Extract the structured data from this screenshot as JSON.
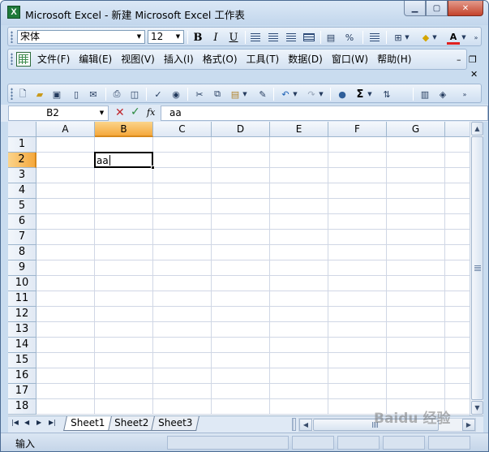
{
  "window": {
    "title": "Microsoft Excel - 新建 Microsoft Excel 工作表",
    "app_icon": "excel-icon",
    "controls": [
      "minimize",
      "maximize",
      "close"
    ]
  },
  "format_toolbar": {
    "font_name": "宋体",
    "font_size": "12",
    "bold_label": "B",
    "italic_label": "I",
    "underline_label": "U",
    "icons": [
      "align-left-icon",
      "align-center-icon",
      "align-right-icon",
      "merge-center-icon",
      "currency-icon",
      "percent-icon",
      "indent-icon",
      "borders-icon",
      "fill-color-icon",
      "font-color-icon"
    ],
    "percent_label": "%",
    "font_color_label": "A"
  },
  "menu": {
    "items": [
      {
        "label": "文件(F)"
      },
      {
        "label": "编辑(E)"
      },
      {
        "label": "视图(V)"
      },
      {
        "label": "插入(I)"
      },
      {
        "label": "格式(O)"
      },
      {
        "label": "工具(T)"
      },
      {
        "label": "数据(D)"
      },
      {
        "label": "窗口(W)"
      },
      {
        "label": "帮助(H)"
      }
    ]
  },
  "standard_toolbar": {
    "icons": [
      "new-icon",
      "open-icon",
      "save-icon",
      "permission-icon",
      "email-icon",
      "print-icon",
      "print-preview-icon",
      "spelling-icon",
      "research-icon",
      "cut-icon",
      "copy-icon",
      "paste-icon",
      "format-painter-icon",
      "undo-icon",
      "redo-icon",
      "hyperlink-icon",
      "autosum-icon",
      "sort-icon",
      "chart-wizard-icon",
      "more-icon"
    ],
    "autosum_label": "Σ"
  },
  "formula_bar": {
    "name_box": "B2",
    "cancel_label": "✕",
    "enter_label": "✓",
    "fx_label": "fx",
    "content": "aa"
  },
  "grid": {
    "columns": [
      "A",
      "B",
      "C",
      "D",
      "E",
      "F",
      "G"
    ],
    "rows": [
      "1",
      "2",
      "3",
      "4",
      "5",
      "6",
      "7",
      "8",
      "9",
      "10",
      "11",
      "12",
      "13",
      "14",
      "15",
      "16",
      "17",
      "18"
    ],
    "active_cell": "B2",
    "active_cell_value": "aa"
  },
  "sheets": {
    "tabs": [
      "Sheet1",
      "Sheet2",
      "Sheet3"
    ],
    "active": "Sheet1"
  },
  "status": {
    "mode": "输入"
  },
  "watermark": "Baidu 经验"
}
